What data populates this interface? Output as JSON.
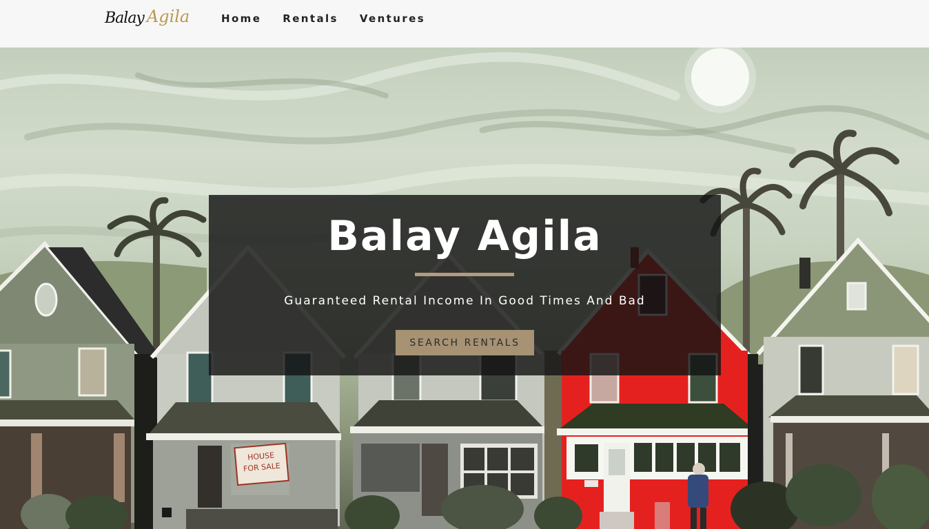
{
  "brand": {
    "logo_word1": "Balay",
    "logo_word2": "Agila"
  },
  "nav": {
    "home": "Home",
    "rentals": "Rentals",
    "ventures": "Ventures"
  },
  "hero": {
    "title": "Balay Agila",
    "tagline": "Guaranteed Rental Income In Good Times And Bad",
    "cta_label": "SEARCH RENTALS",
    "sign_line1": "HOUSE",
    "sign_line2": "FOR SALE"
  },
  "colors": {
    "accent": "#a79273",
    "rule": "#b39c7b",
    "red_house": "#e5211f",
    "panel_bg": "#141414"
  }
}
